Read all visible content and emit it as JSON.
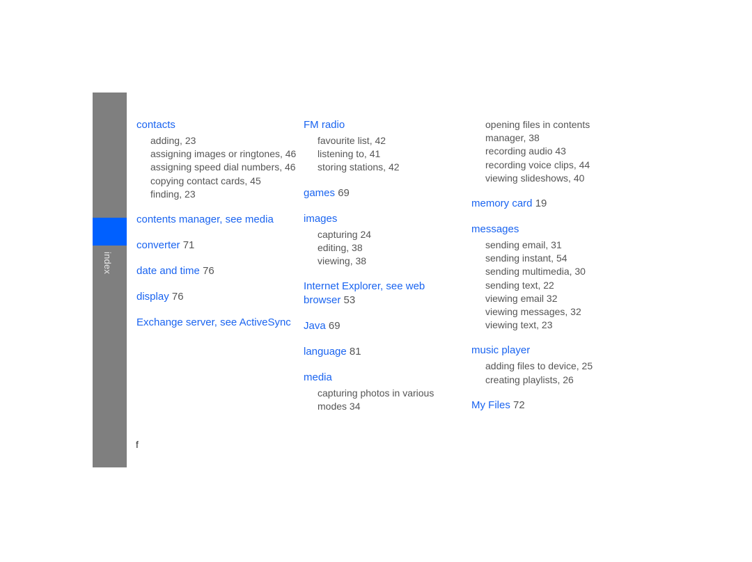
{
  "sidebar": {
    "section_label": "index",
    "accent_color": "#0060ff",
    "bar_color": "#7f7f7f"
  },
  "footer": {
    "letter": "f"
  },
  "columns": [
    {
      "entries": [
        {
          "head": "contacts",
          "page": "",
          "subs": [
            "adding, 23",
            "assigning images or ringtones, 46",
            "assigning speed dial numbers, 46",
            "copying contact cards, 45",
            "finding, 23"
          ]
        },
        {
          "head": "contents manager, see media",
          "page": "",
          "subs": []
        },
        {
          "head": "converter",
          "page": "71",
          "subs": []
        },
        {
          "head": "date and time",
          "page": "76",
          "subs": []
        },
        {
          "head": "display",
          "page": "76",
          "subs": []
        },
        {
          "head": "Exchange server, see ActiveSync",
          "page": "",
          "subs": []
        }
      ]
    },
    {
      "entries": [
        {
          "head": "FM radio",
          "page": "",
          "subs": [
            "favourite list, 42",
            "listening to, 41",
            "storing stations, 42"
          ]
        },
        {
          "head": "games",
          "page": "69",
          "subs": []
        },
        {
          "head": "images",
          "page": "",
          "subs": [
            "capturing 24",
            "editing, 38",
            "viewing, 38"
          ]
        },
        {
          "head": "Internet Explorer, see web browser",
          "page": "53",
          "subs": []
        },
        {
          "head": "Java",
          "page": "69",
          "subs": []
        },
        {
          "head": "language",
          "page": "81",
          "subs": []
        },
        {
          "head": "media",
          "page": "",
          "subs": [
            "capturing photos in various modes 34"
          ]
        }
      ]
    },
    {
      "continued_subs": [
        "opening files in contents manager, 38",
        "recording audio 43",
        "recording voice clips, 44",
        "viewing slideshows, 40"
      ],
      "entries": [
        {
          "head": "memory card",
          "page": "19",
          "subs": []
        },
        {
          "head": "messages",
          "page": "",
          "subs": [
            "sending email, 31",
            "sending instant, 54",
            "sending multimedia, 30",
            "sending text, 22",
            "viewing email 32",
            "viewing messages, 32",
            "viewing text, 23"
          ]
        },
        {
          "head": "music player",
          "page": "",
          "subs": [
            "adding files to device, 25",
            "creating playlists, 26"
          ]
        },
        {
          "head": "My Files",
          "page": "72",
          "subs": []
        }
      ]
    }
  ]
}
